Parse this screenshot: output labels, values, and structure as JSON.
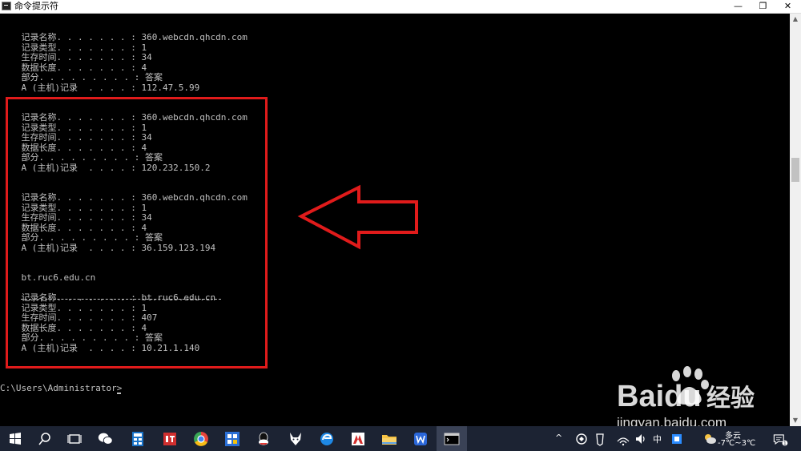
{
  "window": {
    "title": "命令提示符",
    "minimize": "—",
    "maximize": "❐",
    "close": "✕"
  },
  "console_lines": [
    "    记录名称. . . . . . . : 360.webcdn.qhcdn.com",
    "    记录类型. . . . . . . : 1",
    "    生存时间. . . . . . . : 34",
    "    数据长度. . . . . . . : 4",
    "    部分. . . . . . . . . : 答案",
    "    A (主机)记录  . . . . : 112.47.5.99",
    "",
    "",
    "    记录名称. . . . . . . : 360.webcdn.qhcdn.com",
    "    记录类型. . . . . . . : 1",
    "    生存时间. . . . . . . : 34",
    "    数据长度. . . . . . . : 4",
    "    部分. . . . . . . . . : 答案",
    "    A (主机)记录  . . . . : 120.232.150.2",
    "",
    "",
    "    记录名称. . . . . . . : 360.webcdn.qhcdn.com",
    "    记录类型. . . . . . . : 1",
    "    生存时间. . . . . . . : 34",
    "    数据长度. . . . . . . : 4",
    "    部分. . . . . . . . . : 答案",
    "    A (主机)记录  . . . . : 36.159.123.194",
    "",
    "",
    "    bt.ruc6.edu.cn",
    "",
    "    记录名称. . . . . . . : bt.ruc6.edu.cn",
    "    记录类型. . . . . . . : 1",
    "    生存时间. . . . . . . : 407",
    "    数据长度. . . . . . . : 4",
    "    部分. . . . . . . . . : 答案",
    "    A (主机)记录  . . . . : 10.21.1.140",
    "",
    "",
    "",
    "C:\\Users\\Administrator>"
  ],
  "watermark": {
    "brand": "Bai",
    "brand2": "du",
    "cn": "经验",
    "url": "jingyan.baidu.com"
  },
  "taskbar": {
    "tray": {
      "expand": "^",
      "ime": "中",
      "weather_condition": "多云",
      "temperature": "-7℃~3℃",
      "notifications_count": "1"
    }
  },
  "colors": {
    "console_bg": "#000000",
    "console_text": "#c0c0c0",
    "highlight": "#e01b1b",
    "taskbar": "#1c2333"
  }
}
